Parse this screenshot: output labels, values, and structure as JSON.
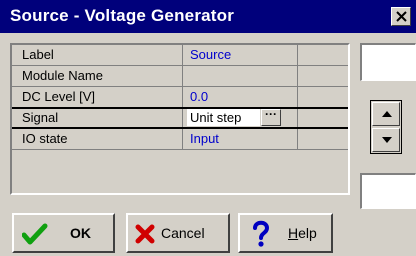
{
  "window": {
    "title": "Source - Voltage Generator"
  },
  "properties": [
    {
      "label": "Label",
      "value": "Source"
    },
    {
      "label": "Module Name",
      "value": ""
    },
    {
      "label": "DC Level [V]",
      "value": "0.0"
    },
    {
      "label": "Signal",
      "value": "Unit step"
    },
    {
      "label": "IO state",
      "value": "Input"
    }
  ],
  "editor": {
    "ellipsis_label": "···"
  },
  "buttons": {
    "ok_label": "OK",
    "cancel_label": "Cancel",
    "help_prefix": "",
    "help_underlined": "H",
    "help_rest": "elp"
  },
  "colors": {
    "titlebar": "#00007b",
    "value_text": "#0000cc",
    "ok_icon": "#10a010",
    "cancel_icon": "#d00000",
    "help_icon": "#0000c0"
  },
  "icons": {
    "close": "close-icon",
    "ok": "checkmark-icon",
    "cancel": "x-icon",
    "help": "question-mark-icon",
    "spin_up": "arrow-up-icon",
    "spin_down": "arrow-down-icon"
  }
}
